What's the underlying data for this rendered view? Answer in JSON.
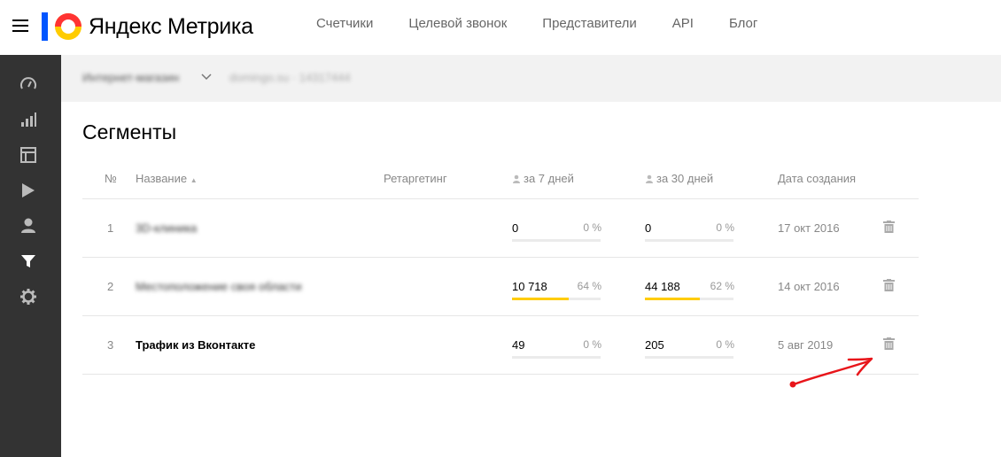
{
  "header": {
    "logo_brand": "Яндекс",
    "logo_product": "Метрика",
    "nav": [
      "Счетчики",
      "Целевой звонок",
      "Представители",
      "API",
      "Блог"
    ]
  },
  "sidebar": {
    "items": [
      "dashboard-icon",
      "reports-icon",
      "layout-icon",
      "play-icon",
      "user-icon",
      "filter-icon",
      "gear-icon"
    ],
    "active": "filter-icon"
  },
  "counter": {
    "name": "Интернет-магазин",
    "site": "domingo.su · 14317444"
  },
  "page": {
    "title": "Сегменты"
  },
  "table": {
    "headers": {
      "no": "№",
      "name": "Название",
      "sort_indicator": "▲",
      "retargeting": "Ретаргетинг",
      "week": "за 7 дней",
      "month": "за 30 дней",
      "created": "Дата создания"
    },
    "rows": [
      {
        "no": "1",
        "name": "3D-клиника",
        "blurred": true,
        "week": "0",
        "week_pct": "0 %",
        "week_frac": 0,
        "month": "0",
        "month_pct": "0 %",
        "month_frac": 0,
        "created": "17 окт 2016"
      },
      {
        "no": "2",
        "name": "Местоположение своя области",
        "blurred": true,
        "week": "10 718",
        "week_pct": "64 %",
        "week_frac": 0.64,
        "month": "44 188",
        "month_pct": "62 %",
        "month_frac": 0.62,
        "created": "14 окт 2016"
      },
      {
        "no": "3",
        "name": "Трафик из Вконтакте",
        "blurred": false,
        "week": "49",
        "week_pct": "0 %",
        "week_frac": 0,
        "month": "205",
        "month_pct": "0 %",
        "month_frac": 0,
        "created": "5 авг 2019"
      }
    ]
  },
  "colors": {
    "accent_bar": "#ffcc00",
    "sidebar_bg": "#333333",
    "annotation_arrow": "#e8151a"
  }
}
